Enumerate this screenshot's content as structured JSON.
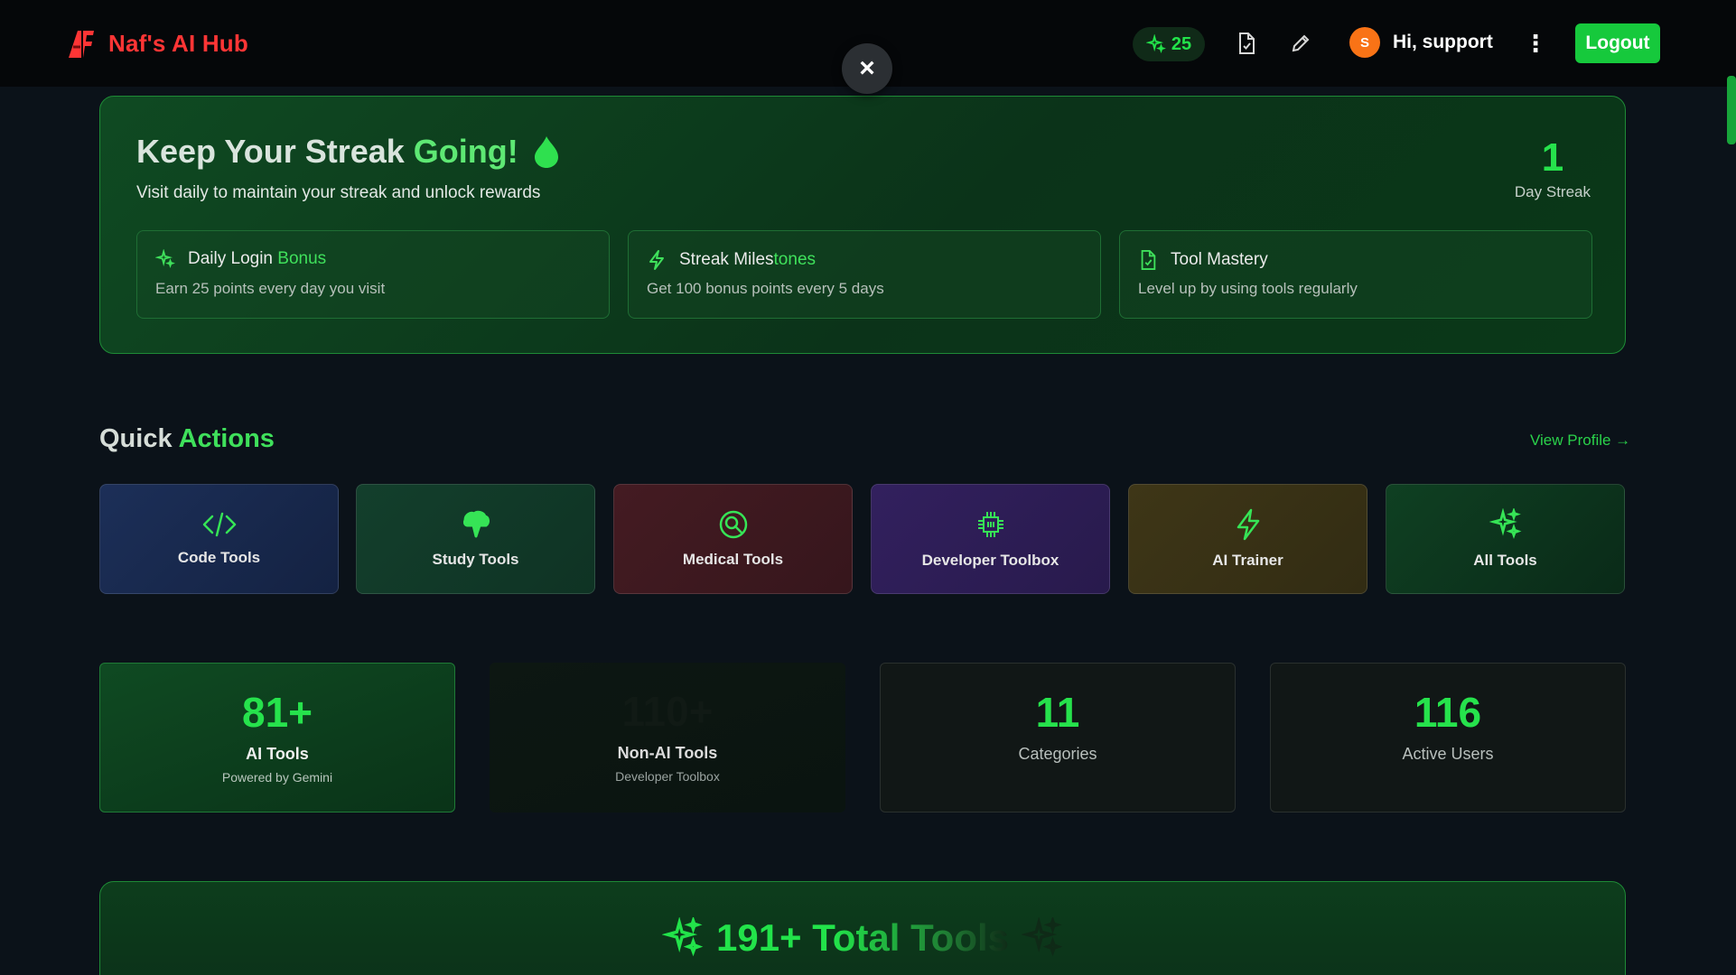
{
  "header": {
    "brand_name": "Naf's AI Hub",
    "points": "25",
    "greeting": "Hi, support",
    "avatar_initial": "S",
    "logout_label": "Logout",
    "close_symbol": "×",
    "menu_symbol": "⋮",
    "icons": [
      "sparkle-icon",
      "document-icon",
      "pencil-icon",
      "kebab-menu-icon",
      "close-icon"
    ]
  },
  "streak": {
    "title_plain": "Keep Your Streak ",
    "title_accent": "Going!",
    "subtitle": "Visit daily to maintain your streak and unlock rewards",
    "count": "1",
    "count_label": "Day Streak",
    "features": [
      {
        "title_plain": "Daily Login ",
        "title_accent": "Bonus",
        "desc": "Earn 25 points every day you visit",
        "icon": "sparkle-icon"
      },
      {
        "title_plain": "Streak Miles",
        "title_accent": "tones",
        "desc": "Get 100 bonus points every 5 days",
        "icon": "lightning-icon"
      },
      {
        "title_plain": "Tool Mastery",
        "title_accent": "",
        "desc": "Level up by using tools regularly",
        "icon": "document-check-icon"
      }
    ]
  },
  "quick_actions": {
    "title_plain": "Quick ",
    "title_accent": "Actions",
    "view_profile": "View Profile →",
    "items": [
      {
        "label": "Code Tools",
        "icon": "code-icon",
        "color": "#1b2c52"
      },
      {
        "label": "Study Tools",
        "icon": "brain-icon",
        "color": "#123a2a"
      },
      {
        "label": "Medical Tools",
        "icon": "stethoscope-icon",
        "color": "#3d1a20"
      },
      {
        "label": "Developer Toolbox",
        "icon": "chip-icon",
        "color": "#2e1f56"
      },
      {
        "label": "AI Trainer",
        "icon": "lightning-icon",
        "color": "#3a3416"
      },
      {
        "label": "All Tools",
        "icon": "sparkles-icon",
        "color": "#0d3a20"
      }
    ]
  },
  "stats": [
    {
      "value": "81+",
      "label": "AI Tools",
      "sub": "Powered by Gemini"
    },
    {
      "value": "110+",
      "label": "Non-AI Tools",
      "sub": "Developer Toolbox"
    },
    {
      "value": "11",
      "label": "Categories",
      "sub": ""
    },
    {
      "value": "116",
      "label": "Active Users",
      "sub": ""
    }
  ],
  "total": {
    "text": "191+ Total Tools"
  },
  "colors": {
    "accent": "#22e34a",
    "brand": "#ff3535",
    "background": "#0b1219"
  }
}
